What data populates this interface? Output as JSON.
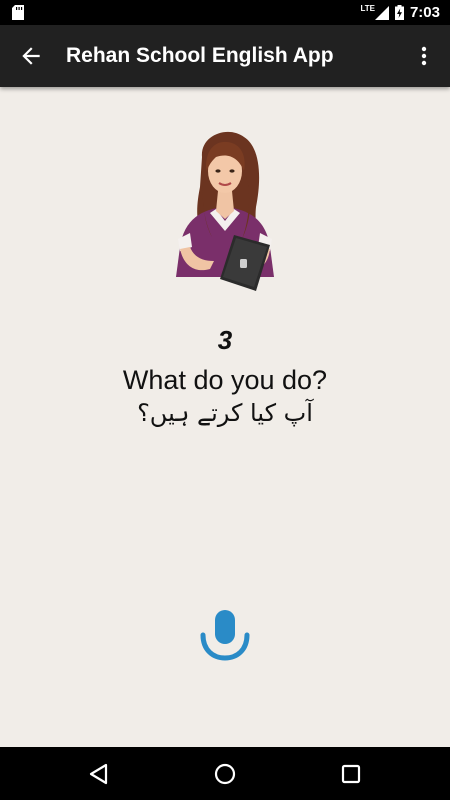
{
  "status_bar": {
    "time": "7:03",
    "network": "LTE",
    "icons": [
      "sd-card-icon",
      "signal-icon",
      "battery-charging-icon"
    ]
  },
  "app_bar": {
    "title": "Rehan School English App",
    "back_icon": "arrow-back-icon",
    "menu_icon": "more-vert-icon"
  },
  "lesson": {
    "number": "3",
    "english": "What do you do?",
    "urdu": "آپ کیا کرتے ہیں؟",
    "image": "teacher-illustration",
    "mic_icon": "microphone-icon"
  },
  "nav_bar": {
    "icons": [
      "nav-back-icon",
      "nav-home-icon",
      "nav-recents-icon"
    ]
  },
  "colors": {
    "background": "#f1ede8",
    "app_bar": "#212121",
    "accent_mic": "#2a8bc7"
  }
}
